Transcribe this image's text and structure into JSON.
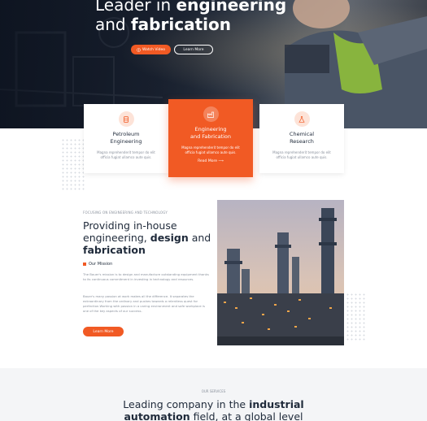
{
  "hero": {
    "title_line1_prefix": "Leader in ",
    "title_line1_bold": "engineering",
    "title_line2_prefix": "and ",
    "title_line2_bold": "fabrication",
    "watch_video_label": "Watch Video",
    "learn_more_label": "Learn More"
  },
  "cards": [
    {
      "title_line1": "Petroleum",
      "title_line2": "Engineering",
      "text": "Magna reprehenderit tempor do elit officia fugiat ullamco aute quis.",
      "icon": "oil-barrel-icon"
    },
    {
      "title_line1": "Engineering",
      "title_line2": "and Fabrication",
      "text": "Magna reprehenderit tempor do elit officia fugiat ullamco aute quis.",
      "read_more": "Read More",
      "icon": "factory-icon"
    },
    {
      "title_line1": "Chemical",
      "title_line2": "Research",
      "text": "Magna reprehenderit tempor do elit officia fugiat ullamco aute quis.",
      "icon": "flask-icon"
    }
  ],
  "about": {
    "eyebrow": "FOCUSING ON ENGINEERING AND TECHNOLOGY",
    "title_line1": "Providing in-house",
    "title_line2_prefix": "engineering, ",
    "title_line2_bold": "design",
    "title_line2_suffix": " and",
    "title_line3_bold": "fabrication",
    "mission_label": "Our Mission",
    "para1": "The Bauer's mission is to design and manufacture outstanding equipment thanks to its continuous commitment in investing in technology and resources.",
    "para2": "Bauer's many passion at work makes all the difference. It separates the extraordinary from the ordinary and pushes towards a relentless quest for perfection.Working with passion in a caring environment and safe workplace is one of the key aspects of our success.",
    "learn_more_label": "Learn More"
  },
  "services": {
    "eyebrow": "OUR SERVICES",
    "title_line1_prefix": "Leading company in the ",
    "title_line1_bold": "industrial",
    "title_line2_bold": "automation",
    "title_line2_suffix": " field, at a global level"
  },
  "colors": {
    "accent": "#f15a24",
    "dark_navy": "#1b2433",
    "text_dark": "#1f2a3a",
    "text_muted": "#8a919c",
    "section_bg": "#f4f5f7"
  }
}
